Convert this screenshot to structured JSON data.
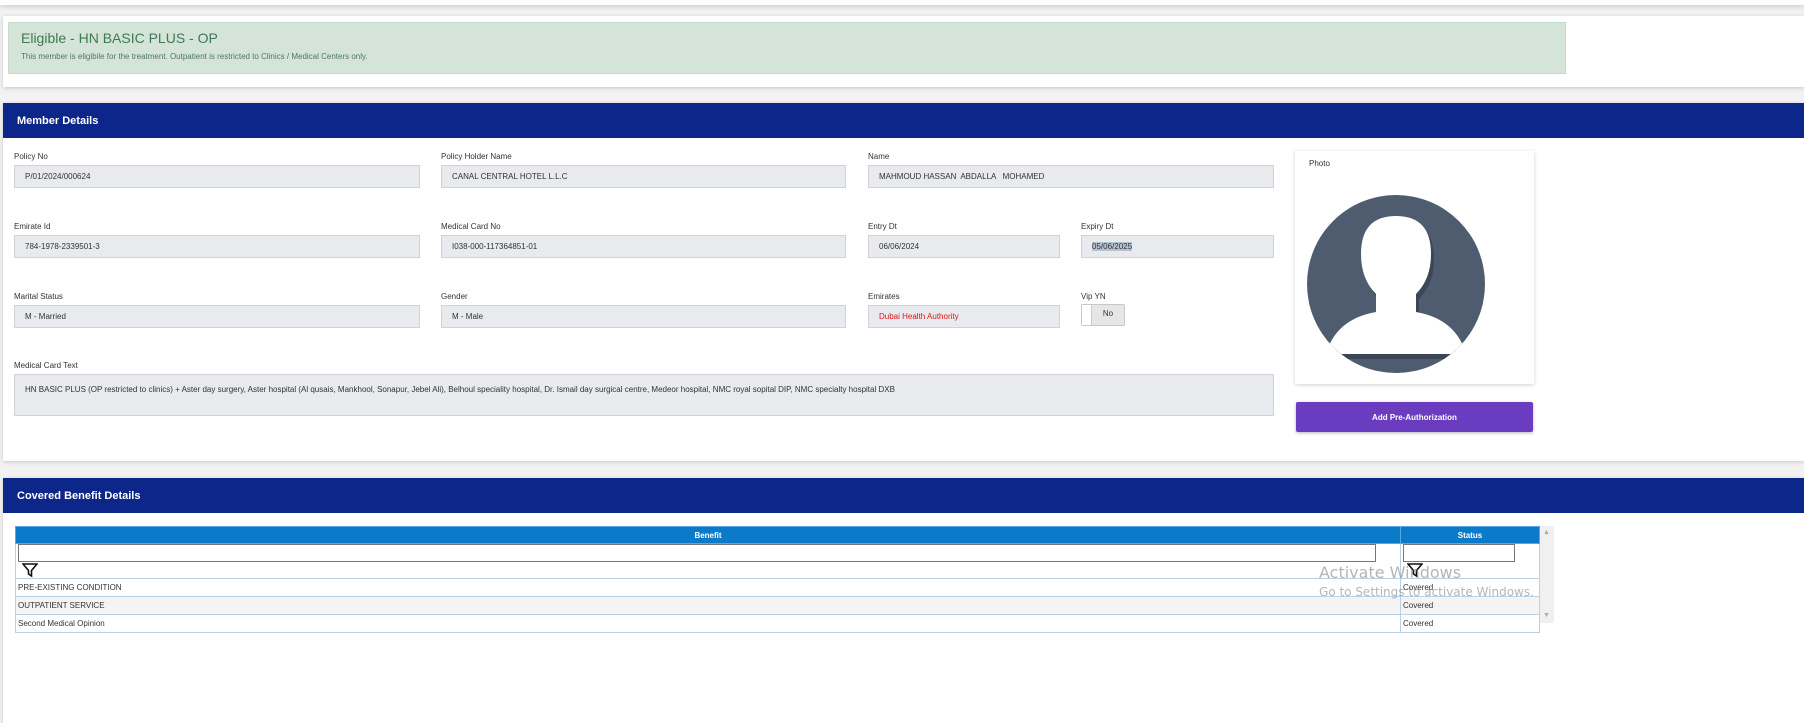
{
  "alert": {
    "title": "Eligible - HN BASIC PLUS - OP",
    "message": "This member is eligibile for the treatment. Outpatient is restricted to Clinics / Medical Centers only."
  },
  "member": {
    "header": "Member Details",
    "policy_no": {
      "label": "Policy No",
      "value": "P/01/2024/000624"
    },
    "policy_holder": {
      "label": "Policy Holder Name",
      "value": "CANAL CENTRAL HOTEL L.L.C"
    },
    "name": {
      "label": "Name",
      "value": "MAHMOUD HASSAN  ABDALLA   MOHAMED"
    },
    "emirate_id": {
      "label": "Emirate Id",
      "value": "784-1978-2339501-3"
    },
    "medical_card_no": {
      "label": "Medical Card No",
      "value": "I038-000-117364851-01"
    },
    "entry_dt": {
      "label": "Entry Dt",
      "value": "06/06/2024"
    },
    "expiry_dt": {
      "label": "Expiry Dt",
      "value": "05/06/2025"
    },
    "marital_status": {
      "label": "Marital Status",
      "value": "M - Married"
    },
    "gender": {
      "label": "Gender",
      "value": "M - Male"
    },
    "emirates": {
      "label": "Emirates",
      "value": "Dubai Health Authority"
    },
    "vip": {
      "label": "Vip YN",
      "value": "No"
    },
    "medical_card_text": {
      "label": "Medical Card Text",
      "value": "HN BASIC PLUS (OP restricted to clinics) + Aster day surgery, Aster hospital (Al qusais, Mankhool, Sonapur, Jebel Ali), Belhoul speciality hospital, Dr. Ismail day surgical centre, Medeor hospital, NMC royal sopital DIP,  NMC specialty hospital DXB"
    },
    "photo_label": "Photo",
    "add_preauth": "Add Pre-Authorization"
  },
  "benefits": {
    "header": "Covered Benefit Details",
    "columns": [
      "Benefit",
      "Status"
    ],
    "rows": [
      {
        "benefit": "PRE-EXISTING CONDITION",
        "status": "Covered"
      },
      {
        "benefit": "OUTPATIENT SERVICE",
        "status": "Covered"
      },
      {
        "benefit": "Second Medical Opinion",
        "status": "Covered"
      }
    ]
  },
  "watermark": {
    "line1": "Activate Windows",
    "line2": "Go to Settings to activate Windows."
  }
}
